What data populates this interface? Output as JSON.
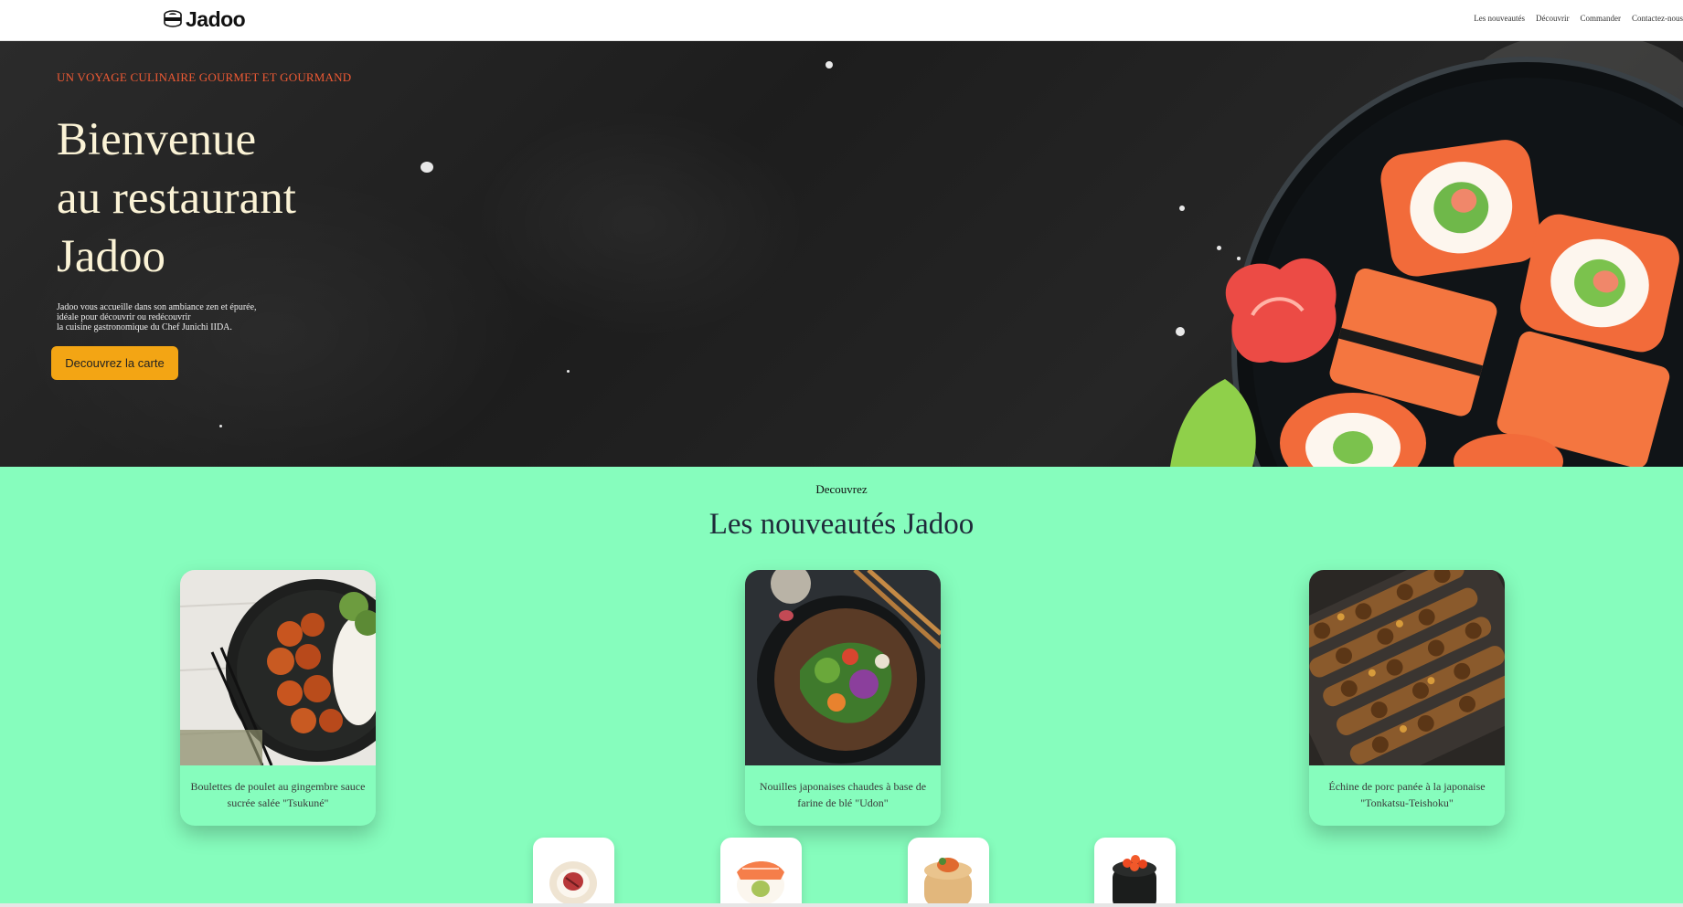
{
  "header": {
    "logo_text": "Jadoo",
    "nav": [
      "Les nouveautés",
      "Découvrir",
      "Commander",
      "Contactez-nous"
    ]
  },
  "hero": {
    "tagline": "UN VOYAGE CULINAIRE GOURMET ET GOURMAND",
    "title_lines": [
      "Bienvenue",
      "au restaurant",
      "Jadoo"
    ],
    "description_lines": [
      "Jadoo vous accueille dans son ambiance zen et épurée,",
      "idéale pour découvrir ou redécouvrir",
      "la cuisine gastronomique du Chef Junichi IIDA."
    ],
    "cta_label": "Decouvrez la carte"
  },
  "news": {
    "kicker": "Decouvrez",
    "title": "Les nouveautés Jadoo",
    "cards": [
      {
        "caption": "Boulettes de poulet au gingembre sauce sucrée salée \"Tsukuné\""
      },
      {
        "caption": "Nouilles japonaises chaudes à base de farine de blé \"Udon\""
      },
      {
        "caption": "Échine de porc panée à la japonaise \"Tonkatsu-Teishoku\""
      }
    ]
  },
  "colors": {
    "accent": "#f3a514",
    "tagline": "#ef5a34",
    "section_bg": "#86fdbd",
    "hero_title": "#fbf3d6"
  }
}
